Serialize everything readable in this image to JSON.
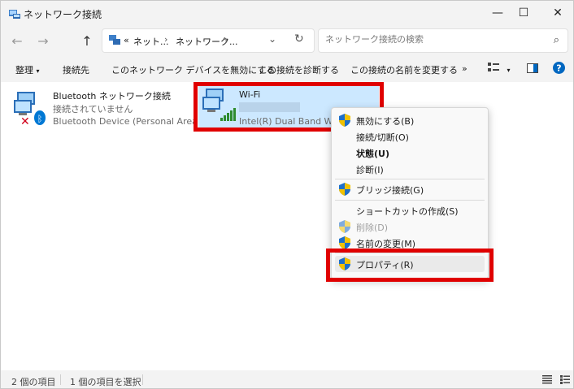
{
  "window": {
    "title": "ネットワーク接続"
  },
  "address": {
    "prefix": "«",
    "crumbs": [
      "ネット...",
      "ネットワーク..."
    ]
  },
  "search": {
    "placeholder": "ネットワーク接続の検索"
  },
  "commands": {
    "organize": "整理",
    "connect_to": "接続先",
    "disable": "このネットワーク デバイスを無効にする",
    "diagnose": "この接続を診断する",
    "rename": "この接続の名前を変更する",
    "more": "»"
  },
  "connections": [
    {
      "name": "Bluetooth ネットワーク接続",
      "status": "接続されていません",
      "device": "Bluetooth Device (Personal Area ..."
    },
    {
      "name": "Wi-Fi",
      "status": "",
      "device": "Intel(R) Dual Band Wirele"
    }
  ],
  "context_menu": {
    "items": [
      {
        "label": "無効にする(B)",
        "shield": true
      },
      {
        "label": "接続/切断(O)",
        "shield": false
      },
      {
        "label": "状態(U)",
        "shield": false,
        "bold": true
      },
      {
        "label": "診断(I)",
        "shield": false
      },
      {
        "label": "ブリッジ接続(G)",
        "shield": true
      },
      {
        "label": "ショートカットの作成(S)",
        "shield": false
      },
      {
        "label": "削除(D)",
        "shield": true,
        "disabled": true
      },
      {
        "label": "名前の変更(M)",
        "shield": true
      },
      {
        "label": "プロパティ(R)",
        "shield": true,
        "highlighted": true
      }
    ]
  },
  "status_bar": {
    "count": "2 個の項目",
    "selected": "1 個の項目を選択"
  },
  "colors": {
    "highlight_box": "#e00000",
    "selection": "#cce8ff",
    "accent": "#0067c0"
  }
}
